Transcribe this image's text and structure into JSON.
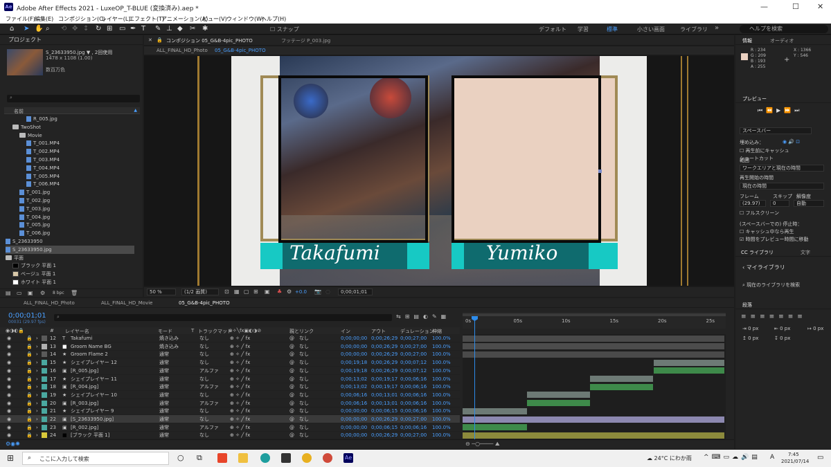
{
  "window": {
    "title": "Adobe After Effects 2021 - LuxeOP_T-BLUE (変換済み).aep *",
    "logo": "Ae"
  },
  "menu": [
    "ファイル(F)",
    "編集(E)",
    "コンポジション(C)",
    "レイヤー(L)",
    "エフェクト(T)",
    "アニメーション(A)",
    "ビュー(V)",
    "ウィンドウ(W)",
    "ヘルプ(H)"
  ],
  "toolbar": {
    "snap_label": "スナップ",
    "workspaces": [
      "デフォルト",
      "学習",
      "標準",
      "小さい画面",
      "ライブラリ"
    ],
    "help_search_placeholder": "ヘルプを検索"
  },
  "project": {
    "panel_title": "プロジェクト",
    "asset_name": "S_23633950.jpg ▼ , 2回使用",
    "asset_size": "1478 x 1108 (1.00)",
    "asset_colors": "数百万色",
    "column_name": "名前",
    "bpc": "8 bpc",
    "items": [
      {
        "name": "R_005.jpg",
        "kind": "file",
        "indent": 3
      },
      {
        "name": "TwoShot",
        "kind": "folder",
        "indent": 1
      },
      {
        "name": "Movie",
        "kind": "folder",
        "indent": 2
      },
      {
        "name": "T_001.MP4",
        "kind": "file",
        "indent": 3
      },
      {
        "name": "T_002.MP4",
        "kind": "file",
        "indent": 3
      },
      {
        "name": "T_003.MP4",
        "kind": "file",
        "indent": 3
      },
      {
        "name": "T_004.MP4",
        "kind": "file",
        "indent": 3
      },
      {
        "name": "T_005.MP4",
        "kind": "file",
        "indent": 3
      },
      {
        "name": "T_006.MP4",
        "kind": "file",
        "indent": 3
      },
      {
        "name": "T_001.jpg",
        "kind": "file",
        "indent": 2
      },
      {
        "name": "T_002.jpg",
        "kind": "file",
        "indent": 2
      },
      {
        "name": "T_003.jpg",
        "kind": "file",
        "indent": 2
      },
      {
        "name": "T_004.jpg",
        "kind": "file",
        "indent": 2
      },
      {
        "name": "T_005.jpg",
        "kind": "file",
        "indent": 2
      },
      {
        "name": "T_006.jpg",
        "kind": "file",
        "indent": 2
      },
      {
        "name": "S_23633950",
        "kind": "file",
        "indent": 0
      },
      {
        "name": "S_23633950.jpg",
        "kind": "file",
        "indent": 0
      },
      {
        "name": "平面",
        "kind": "folder",
        "indent": 0
      },
      {
        "name": "ブラック 平面 1",
        "kind": "solid",
        "indent": 1,
        "color": "#000000"
      },
      {
        "name": "ベージュ 平面 1",
        "kind": "solid",
        "indent": 1,
        "color": "#d8c8a8"
      },
      {
        "name": "ホワイト 平面 1",
        "kind": "solid",
        "indent": 1,
        "color": "#ffffff"
      }
    ]
  },
  "composition": {
    "panel_title": "コンポジション 05_G&B-4pic_PHOTO",
    "footage_tab": "フッテージ P_003.jpg",
    "sub_tabs": [
      "ALL_FINAL_HD_Photo",
      "05_G&B-4pic_PHOTO"
    ],
    "name_left": "Takafumi",
    "name_right": "Yumiko",
    "zoom": "50 %",
    "resolution": "(1/2 画質)",
    "exposure": "+0.0",
    "timecode": "0;00;01;01"
  },
  "timeline": {
    "tabs": [
      "ALL_FINAL_HD_Photo",
      "ALL_FINAL_HD_Movie",
      "05_G&B-4pic_PHOTO"
    ],
    "current_time": "0;00;01;01",
    "fps_info": "00031 (29.97 fps)",
    "columns": [
      "#",
      "レイヤー名",
      "モード",
      "T",
      "トラックマット",
      "親とリンク",
      "イン",
      "アウト",
      "デュレーション",
      "伸縮"
    ],
    "ruler": [
      "0s",
      "05s",
      "10s",
      "15s",
      "20s",
      "25s"
    ],
    "layers": [
      {
        "num": "12",
        "name": "Takafumi",
        "mode": "焼き込み",
        "matte": "なし",
        "parent": "なし",
        "in": "0;00;00;00",
        "out": "0;00;26;29",
        "dur": "0;00;27;00",
        "stretch": "100.0%",
        "label": "#5a5a5a",
        "icon": "T",
        "bar_start": 0.0,
        "bar_end": 0.995,
        "bar": "#4a4a4a"
      },
      {
        "num": "13",
        "name": "Groom Name BG",
        "mode": "焼き込み",
        "matte": "なし",
        "parent": "なし",
        "in": "0;00;00;00",
        "out": "0;00;26;29",
        "dur": "0;00;27;00",
        "stretch": "100.0%",
        "label": "#b0b0b0",
        "icon": "solid",
        "bar_start": 0.0,
        "bar_end": 0.995,
        "bar": "#4c4c4c"
      },
      {
        "num": "14",
        "name": "Groom Flame 2",
        "mode": "通常",
        "matte": "なし",
        "parent": "なし",
        "in": "0;00;00;00",
        "out": "0;00;26;29",
        "dur": "0;00;27;00",
        "stretch": "100.0%",
        "label": "#5a5a5a",
        "icon": "star",
        "bar_start": 0.0,
        "bar_end": 0.995,
        "bar": "#4a4a4a"
      },
      {
        "num": "15",
        "name": "シェイプレイヤー 12",
        "mode": "通常",
        "matte": "なし",
        "parent": "なし",
        "in": "0;00;19;18",
        "out": "0;00;26;29",
        "dur": "0;00;07;12",
        "stretch": "100.0%",
        "label": "#4aa8a0",
        "icon": "star",
        "bar_start": 0.725,
        "bar_end": 0.995,
        "bar": "#6d7a75"
      },
      {
        "num": "16",
        "name": "[R_005.jpg]",
        "mode": "通常",
        "matte": "アルファ",
        "parent": "なし",
        "in": "0;00;19;18",
        "out": "0;00;26;29",
        "dur": "0;00;07;12",
        "stretch": "100.0%",
        "label": "#4aa8a0",
        "icon": "img",
        "bar_start": 0.725,
        "bar_end": 0.995,
        "bar": "#3e8a4a"
      },
      {
        "num": "17",
        "name": "シェイプレイヤー 11",
        "mode": "通常",
        "matte": "なし",
        "parent": "なし",
        "in": "0;00;13;02",
        "out": "0;00;19;17",
        "dur": "0;00;06;16",
        "stretch": "100.0%",
        "label": "#4aa8a0",
        "icon": "star",
        "bar_start": 0.483,
        "bar_end": 0.725,
        "bar": "#6d7a75"
      },
      {
        "num": "18",
        "name": "[R_004.jpg]",
        "mode": "通常",
        "matte": "アルファ",
        "parent": "なし",
        "in": "0;00;13;02",
        "out": "0;00;19;17",
        "dur": "0;00;06;16",
        "stretch": "100.0%",
        "label": "#4aa8a0",
        "icon": "img",
        "bar_start": 0.483,
        "bar_end": 0.725,
        "bar": "#3e8a4a"
      },
      {
        "num": "19",
        "name": "シェイプレイヤー 10",
        "mode": "通常",
        "matte": "なし",
        "parent": "なし",
        "in": "0;00;06;16",
        "out": "0;00;13;01",
        "dur": "0;00;06;16",
        "stretch": "100.0%",
        "label": "#4aa8a0",
        "icon": "star",
        "bar_start": 0.244,
        "bar_end": 0.483,
        "bar": "#6d7a75"
      },
      {
        "num": "20",
        "name": "[R_003.jpg]",
        "mode": "通常",
        "matte": "アルファ",
        "parent": "なし",
        "in": "0;00;06;16",
        "out": "0;00;13;01",
        "dur": "0;00;06;16",
        "stretch": "100.0%",
        "label": "#4aa8a0",
        "icon": "img",
        "bar_start": 0.244,
        "bar_end": 0.483,
        "bar": "#3e8a4a"
      },
      {
        "num": "21",
        "name": "シェイプレイヤー 9",
        "mode": "通常",
        "matte": "なし",
        "parent": "なし",
        "in": "0;00;00;00",
        "out": "0;00;06;15",
        "dur": "0;00;06;16",
        "stretch": "100.0%",
        "label": "#4aa8a0",
        "icon": "star",
        "bar_start": 0.0,
        "bar_end": 0.244,
        "bar": "#6d7a75"
      },
      {
        "num": "22",
        "name": "[S_23633950.jpg]",
        "mode": "通常",
        "matte": "なし",
        "parent": "なし",
        "in": "0;00;00;00",
        "out": "0;00;26;29",
        "dur": "0;00;27;00",
        "stretch": "100.0%",
        "label": "#4aa8a0",
        "icon": "img",
        "bar_start": 0.0,
        "bar_end": 0.995,
        "bar": "#8c88b0",
        "selected": true
      },
      {
        "num": "23",
        "name": "[R_002.jpg]",
        "mode": "通常",
        "matte": "アルファ",
        "parent": "なし",
        "in": "0;00;00;00",
        "out": "0;00;06;15",
        "dur": "0;00;06;16",
        "stretch": "100.0%",
        "label": "#4aa8a0",
        "icon": "img",
        "bar_start": 0.0,
        "bar_end": 0.244,
        "bar": "#3e8a4a"
      },
      {
        "num": "24",
        "name": "[ブラック 平面 1]",
        "mode": "通常",
        "matte": "なし",
        "parent": "なし",
        "in": "0;00;00;00",
        "out": "0;00;26;29",
        "dur": "0;00;27;00",
        "stretch": "100.0%",
        "label": "#d8c83a",
        "icon": "solid-black",
        "bar_start": 0.0,
        "bar_end": 0.995,
        "bar": "#8c8a3c"
      }
    ]
  },
  "info": {
    "tabs": [
      "情報",
      "オーディオ"
    ],
    "R": "R : 234",
    "G": "G : 209",
    "B": "B : 193",
    "A": "A : 255",
    "X": "X : 1366",
    "Y": "Y : 546"
  },
  "preview": {
    "title": "プレビュー",
    "shortcut_label": "ショートカット",
    "shortcut": "スペースバー",
    "include_label": "埋め込み：",
    "cache_before": "再生前にキャッシュ",
    "range_label": "範囲",
    "range": "ワークエリアと現在の時間",
    "start_label": "再生開始の時間",
    "start": "現在の時間",
    "frame_label": "フレーム",
    "skip_label": "スキップ",
    "res_label": "解像度",
    "frame": "(29.97)",
    "skip": "0",
    "res": "自動",
    "fullscreen": "フルスクリーン",
    "stop_label": "(スペースバーでの) 停止時：",
    "stop_opt1": "キャッシュ中なら再生",
    "stop_opt2": "時間をプレビュー時間に移動"
  },
  "library": {
    "tabs": [
      "CC ライブラリ",
      "文字"
    ],
    "my_library": "マイライブラリ",
    "search_placeholder": "現在のライブラリを検索"
  },
  "paragraph": {
    "title": "段落",
    "px": "0 px"
  },
  "taskbar": {
    "search_placeholder": "ここに入力して検索",
    "weather": "24°C にわか雨",
    "ime": "A",
    "time": "7:45",
    "date": "2021/07/14"
  },
  "colors": {
    "accent": "#2d8ceb",
    "teal": "#17c9c4",
    "gold": "#a08a55",
    "beige": "#ead1c1"
  }
}
